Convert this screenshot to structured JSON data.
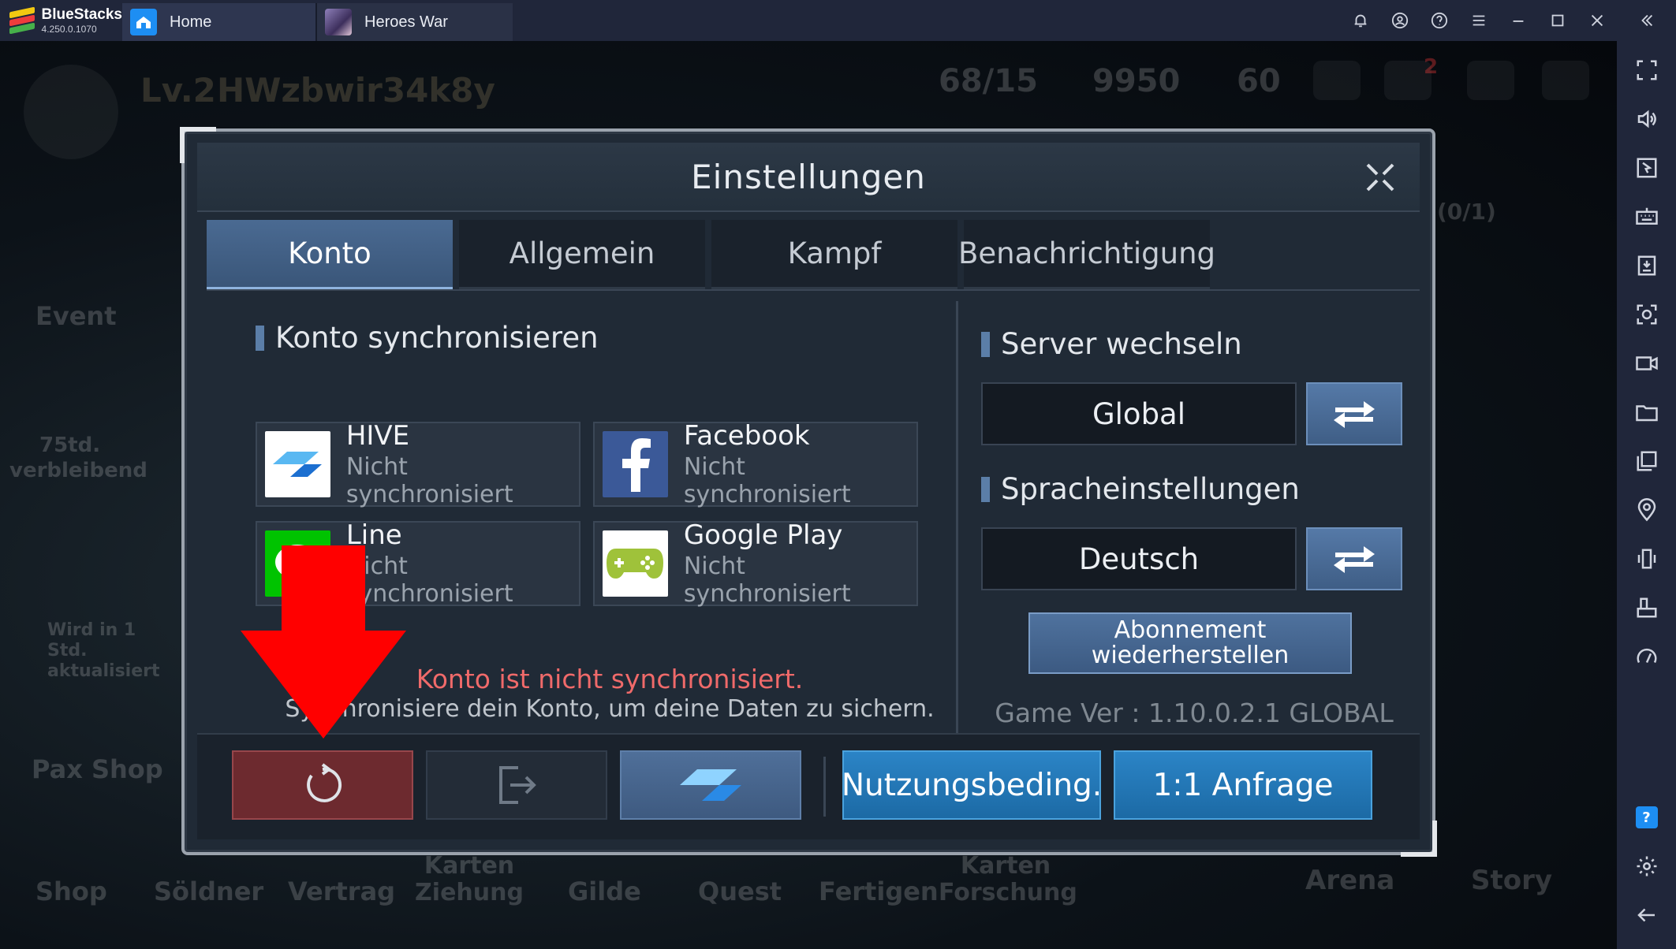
{
  "titlebar": {
    "app_name": "BlueStacks",
    "app_version": "4.250.0.1070",
    "tabs": [
      {
        "label": "Home"
      },
      {
        "label": "Heroes War"
      }
    ]
  },
  "game_hud": {
    "level": "Lv.2",
    "player_name": "HWzbwir34k8y",
    "stamina": "68/15",
    "gold": "9950",
    "gems": "60",
    "mail_badge": "2",
    "quest_progress": "(0/1)",
    "event_label": "Event",
    "event_timer": "75td.",
    "event_remaining": "verbleibend",
    "refresh_note": "Wird in 1 Std. aktualisiert",
    "pax_shop": "Pax Shop",
    "arena": "Arena",
    "story": "Story",
    "bottom_nav": [
      "Shop",
      "Söldner",
      "Vertrag",
      "Karten Ziehung",
      "Gilde",
      "Quest",
      "Fertigen",
      "Karten Forschung"
    ]
  },
  "dialog": {
    "title": "Einstellungen",
    "tabs": [
      {
        "label": "Konto",
        "active": true
      },
      {
        "label": "Allgemein",
        "active": false
      },
      {
        "label": "Kampf",
        "active": false
      },
      {
        "label": "Benachrichtigung",
        "active": false
      }
    ],
    "sync_section": {
      "heading": "Konto synchronisieren",
      "accounts": [
        {
          "name": "HIVE",
          "status": "Nicht synchronisiert",
          "icon": "hive-icon"
        },
        {
          "name": "Facebook",
          "status": "Nicht synchronisiert",
          "icon": "facebook-icon"
        },
        {
          "name": "Line",
          "status": "Nicht synchronisiert",
          "icon": "line-icon"
        },
        {
          "name": "Google Play",
          "status": "Nicht synchronisiert",
          "icon": "google-play-icon"
        }
      ],
      "warning": "Konto ist nicht synchronisiert.",
      "hint": "Synchronisiere dein Konto, um deine Daten zu sichern."
    },
    "server_section": {
      "heading": "Server wechseln",
      "value": "Global"
    },
    "language_section": {
      "heading": "Spracheinstellungen",
      "value": "Deutsch"
    },
    "restore_button": {
      "line1": "Abonnement",
      "line2": "wiederherstellen"
    },
    "game_version": "Game Ver : 1.10.0.2.1 GLOBAL",
    "footer": {
      "reset_icon": "refresh-icon",
      "logout_icon": "logout-icon",
      "hive_icon": "hive-icon",
      "terms_label": "Nutzungsbeding.",
      "inquiry_label": "1:1 Anfrage"
    }
  },
  "colors": {
    "annotation_arrow": "#ff0000",
    "accent_blue": "#1c6aa5",
    "warning_red": "#f06a6a"
  }
}
